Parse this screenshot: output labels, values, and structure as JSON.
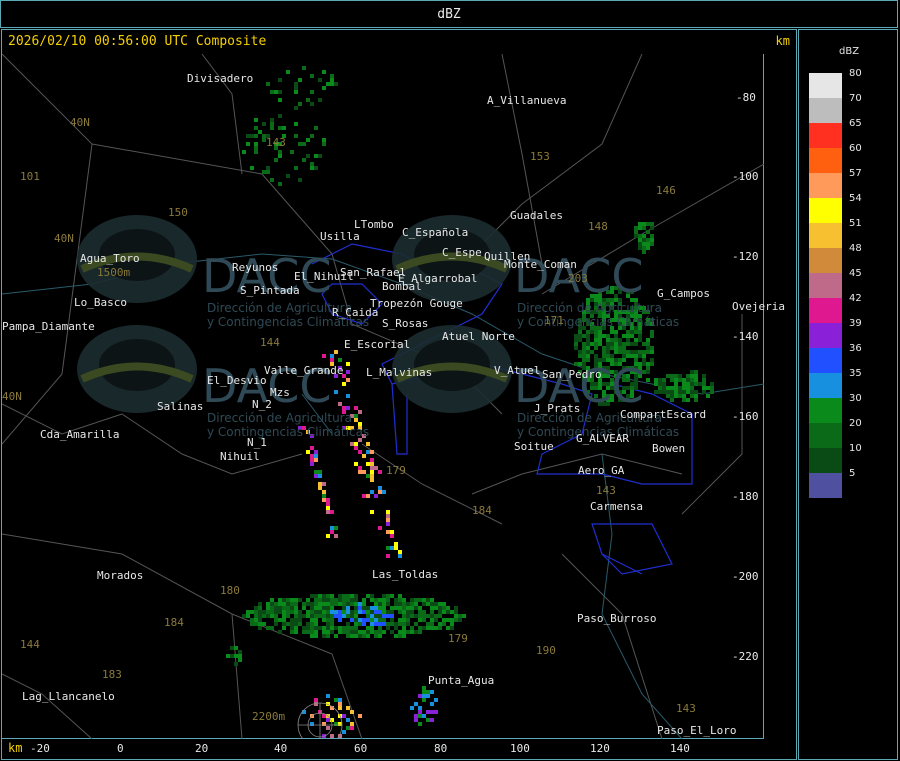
{
  "window": {
    "title": "dBZ"
  },
  "map": {
    "timestamp_label": "2026/02/10 00:56:00 UTC Composite",
    "unit_top": "km",
    "unit_bottom": "km",
    "x_ticks": [
      "-20",
      "0",
      "20",
      "40",
      "60",
      "80",
      "100",
      "120",
      "140"
    ],
    "y_ticks": [
      "-80",
      "-100",
      "-120",
      "-140",
      "-160",
      "-180",
      "-200",
      "-220"
    ],
    "places": [
      "Divisadero",
      "A_Villanueva",
      "Guadales",
      "LTombo",
      "C_Española",
      "Usilla",
      "C_Espe",
      "Atuel Norte",
      "San_Pedro",
      "Agua_Toro",
      "Reyunos",
      "S_Pintada",
      "El_Desvio",
      "Salinas",
      "N_2",
      "N_1",
      "Nihuil",
      "Cda_Amarilla",
      "Pampa_Diamante",
      "Valle_Grande",
      "L_Malvinas",
      "V_Atuel",
      "R_Caida",
      "S_Rosas",
      "E_Escorial",
      "J_Prats",
      "G_ALVEAR",
      "Soitue",
      "Bowen",
      "CompartEscard",
      "Aero_GA",
      "Carmensa",
      "Las_Toldas",
      "Punta_Agua",
      "Paso_Burroso",
      "Paso_El_Loro",
      "Lag_Llancanelo",
      "Morados",
      "Ovejeria",
      "G_Campos",
      "Lo_Basco",
      "San_Rafael",
      "E_Algarrobal",
      "Mzs",
      "Tropezón Gouge",
      "Quillen",
      "Monte_Coman",
      "Bombal",
      "El_Nihuil"
    ],
    "road_numbers": [
      "143",
      "150",
      "101",
      "40N",
      "40N",
      "153",
      "146",
      "148",
      "171",
      "203",
      "144",
      "179",
      "184",
      "180",
      "184",
      "183",
      "143",
      "190",
      "179",
      "144",
      "143",
      "40N"
    ],
    "watermark": {
      "brand": "DACC",
      "line1": "Dirección de Agricultura",
      "line2": "y Contingencias Climáticas",
      "elevation1": "1500m",
      "elevation2": "2200m"
    }
  },
  "legend": {
    "title": "dBZ",
    "entries": [
      {
        "value": "80",
        "color": "#e6e6e6"
      },
      {
        "value": "70",
        "color": "#bdbdbd"
      },
      {
        "value": "65",
        "color": "#ff3020"
      },
      {
        "value": "60",
        "color": "#ff6010"
      },
      {
        "value": "57",
        "color": "#ff9a5a"
      },
      {
        "value": "54",
        "color": "#ffff00"
      },
      {
        "value": "51",
        "color": "#f6c030"
      },
      {
        "value": "48",
        "color": "#d08a3a"
      },
      {
        "value": "45",
        "color": "#c06a8a"
      },
      {
        "value": "42",
        "color": "#e01890"
      },
      {
        "value": "39",
        "color": "#8a20d8"
      },
      {
        "value": "36",
        "color": "#2050ff"
      },
      {
        "value": "35",
        "color": "#1890e0"
      },
      {
        "value": "30",
        "color": "#0a8a1a"
      },
      {
        "value": "20",
        "color": "#0a6a18"
      },
      {
        "value": "10",
        "color": "#0a4a14"
      },
      {
        "value": "5",
        "color": "#5050a0"
      }
    ]
  }
}
